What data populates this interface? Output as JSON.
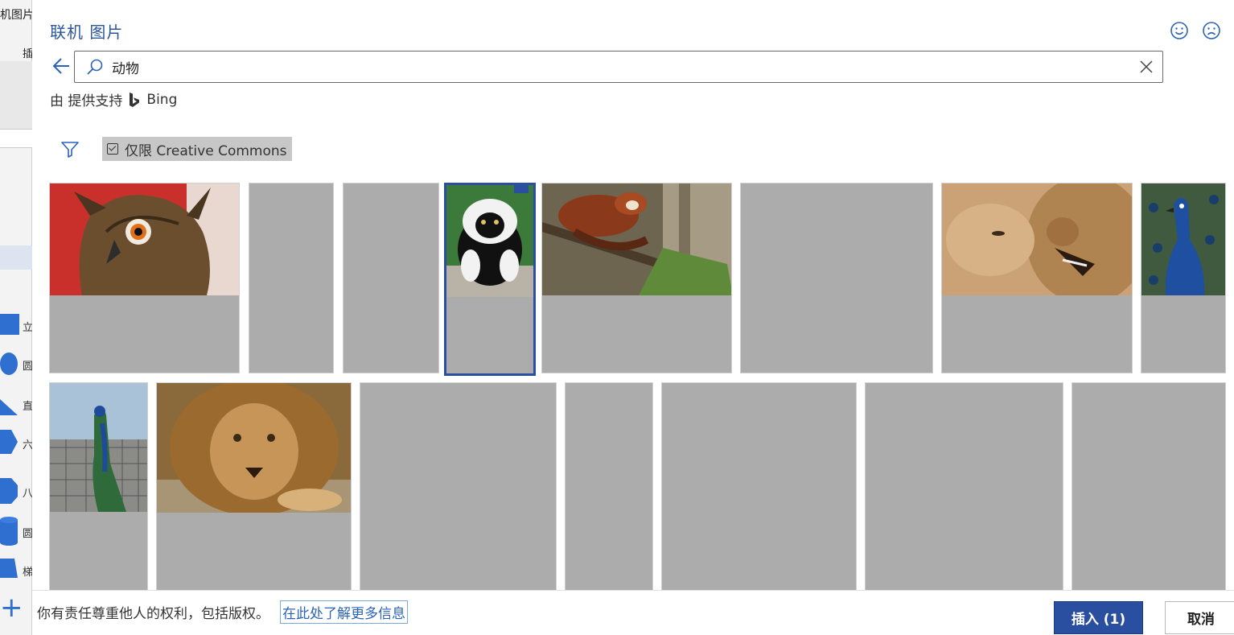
{
  "background_app": {
    "ribbon_label": "机图片",
    "ribbon_label_2": "插",
    "shape_labels": [
      "立",
      "圆",
      "直",
      "六",
      "八",
      "圆",
      "梯"
    ]
  },
  "dialog": {
    "title": "联机 图片",
    "feedback": {
      "smile_icon": "smile-icon",
      "frown_icon": "frown-icon"
    },
    "search": {
      "value": "动物",
      "placeholder": ""
    },
    "powered_by": {
      "prefix": "由 提供支持",
      "provider": "Bing"
    },
    "filter": {
      "icon": "filter-icon",
      "creative_commons_label": "仅限 Creative Commons",
      "creative_commons_checked": true
    },
    "results": [
      {
        "name": "owl",
        "loaded": true
      },
      {
        "name": "placeholder",
        "loaded": false
      },
      {
        "name": "placeholder",
        "loaded": false
      },
      {
        "name": "lemur",
        "loaded": true,
        "selected": true
      },
      {
        "name": "red-panda",
        "loaded": true
      },
      {
        "name": "placeholder",
        "loaded": false
      },
      {
        "name": "lion-cubs",
        "loaded": true
      },
      {
        "name": "peacock",
        "loaded": true
      },
      {
        "name": "peacock-on-fence",
        "loaded": true
      },
      {
        "name": "lion",
        "loaded": true
      },
      {
        "name": "placeholder",
        "loaded": false
      },
      {
        "name": "placeholder",
        "loaded": false
      },
      {
        "name": "placeholder",
        "loaded": false
      },
      {
        "name": "placeholder",
        "loaded": false
      },
      {
        "name": "placeholder",
        "loaded": false
      }
    ],
    "footer": {
      "rights_text": "你有责任尊重他人的权利，包括版权。",
      "learn_more": "在此处了解更多信息",
      "insert_label": "插入 (1)",
      "cancel_label": "取消"
    },
    "colors": {
      "accent": "#2b4fa0",
      "title": "#2b579a",
      "link": "#2b63b8",
      "placeholder_tile": "#acacac"
    }
  }
}
